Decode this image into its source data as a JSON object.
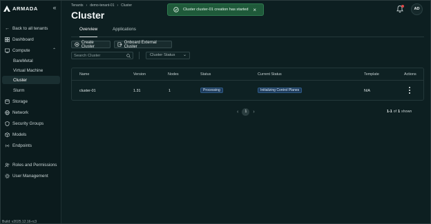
{
  "app": {
    "logo_text": "ARMADA",
    "build": "Build: v2025.12.16-rc3"
  },
  "sidebar": {
    "back": "Back to all tenants",
    "items": [
      {
        "label": "Dashboard",
        "icon": "grid-icon"
      },
      {
        "label": "Compute",
        "icon": "compute-icon"
      },
      {
        "label": "BareMetal",
        "icon": ""
      },
      {
        "label": "Virtual Machine",
        "icon": ""
      },
      {
        "label": "Cluster",
        "icon": "",
        "active": true
      },
      {
        "label": "Slurm",
        "icon": ""
      },
      {
        "label": "Storage",
        "icon": "database-icon"
      },
      {
        "label": "Network",
        "icon": "globe-icon"
      },
      {
        "label": "Security Groups",
        "icon": "shield-icon"
      },
      {
        "label": "Models",
        "icon": "cube-icon"
      },
      {
        "label": "Endpoints",
        "icon": "broadcast-icon"
      },
      {
        "label": "Roles and Permissions",
        "icon": "users-icon"
      },
      {
        "label": "User Management",
        "icon": "user-gear-icon"
      }
    ]
  },
  "breadcrumb": [
    "Tenants",
    "demo-tenant-01",
    "Cluster"
  ],
  "page": {
    "title": "Cluster"
  },
  "toast": {
    "message": "Cluster cluster-01 creation has started"
  },
  "header": {
    "avatar": "AD"
  },
  "tabs": [
    "Overview",
    "Applications"
  ],
  "toolbar": {
    "create": "Create Cluster",
    "onboard": "Onboard External Cluster"
  },
  "filters": {
    "search_placeholder": "Search Cluster",
    "status_placeholder": "Cluster Status"
  },
  "table": {
    "columns": [
      "Name",
      "Version",
      "Nodes",
      "Status",
      "Current Status",
      "Template",
      "Actions"
    ],
    "rows": [
      {
        "name": "cluster-01",
        "version": "1.31",
        "nodes": "1",
        "status": "Processing",
        "current_status": "Initializing Control Planes",
        "template": "N/A"
      }
    ]
  },
  "pagination": {
    "page": "1",
    "range": "1-1",
    "of_label": "of",
    "total": "1",
    "shown_label": "shown"
  },
  "colors": {
    "accent_badge": "#1c3a5a",
    "toast_bg": "#1f5a3a",
    "background": "#0d1f21"
  }
}
